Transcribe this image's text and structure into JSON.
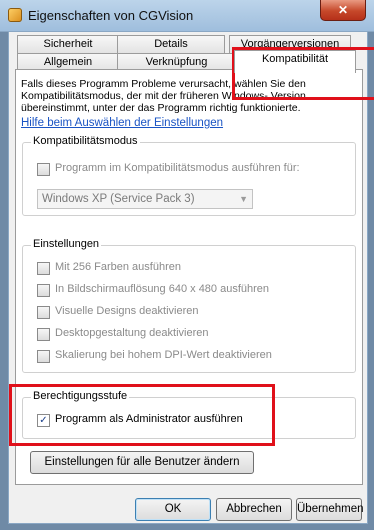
{
  "window": {
    "title": "Eigenschaften von CGVision",
    "close_label": "✕"
  },
  "tabs": {
    "row1": [
      "Sicherheit",
      "Details",
      "Vorgängerversionen"
    ],
    "row2": [
      "Allgemein",
      "Verknüpfung",
      "Kompatibilität"
    ]
  },
  "intro_text": "Falls dieses Programm Probleme verursacht, wählen Sie den Kompatibilitätsmodus, der mit der früheren Windows- Version übereinstimmt, unter der das Programm richtig funktionierte.",
  "help_link": "Hilfe beim Auswählen der Einstellungen",
  "compat_mode": {
    "legend": "Kompatibilitätsmodus",
    "checkbox_label": "Programm im Kompatibilitätsmodus ausführen für:",
    "select_value": "Windows XP (Service Pack 3)"
  },
  "settings": {
    "legend": "Einstellungen",
    "options": [
      "Mit 256 Farben ausführen",
      "In Bildschirmauflösung 640 x 480 ausführen",
      "Visuelle Designs deaktivieren",
      "Desktopgestaltung deaktivieren",
      "Skalierung bei hohem DPI-Wert deaktivieren"
    ]
  },
  "privilege": {
    "legend": "Berechtigungsstufe",
    "checkbox_label": "Programm als Administrator ausführen",
    "checked": true
  },
  "all_users_button": "Einstellungen für alle Benutzer ändern",
  "footer": {
    "ok": "OK",
    "cancel": "Abbrechen",
    "apply": "Übernehmen"
  },
  "colors": {
    "highlight": "#e0101a",
    "link": "#1a54c4"
  }
}
